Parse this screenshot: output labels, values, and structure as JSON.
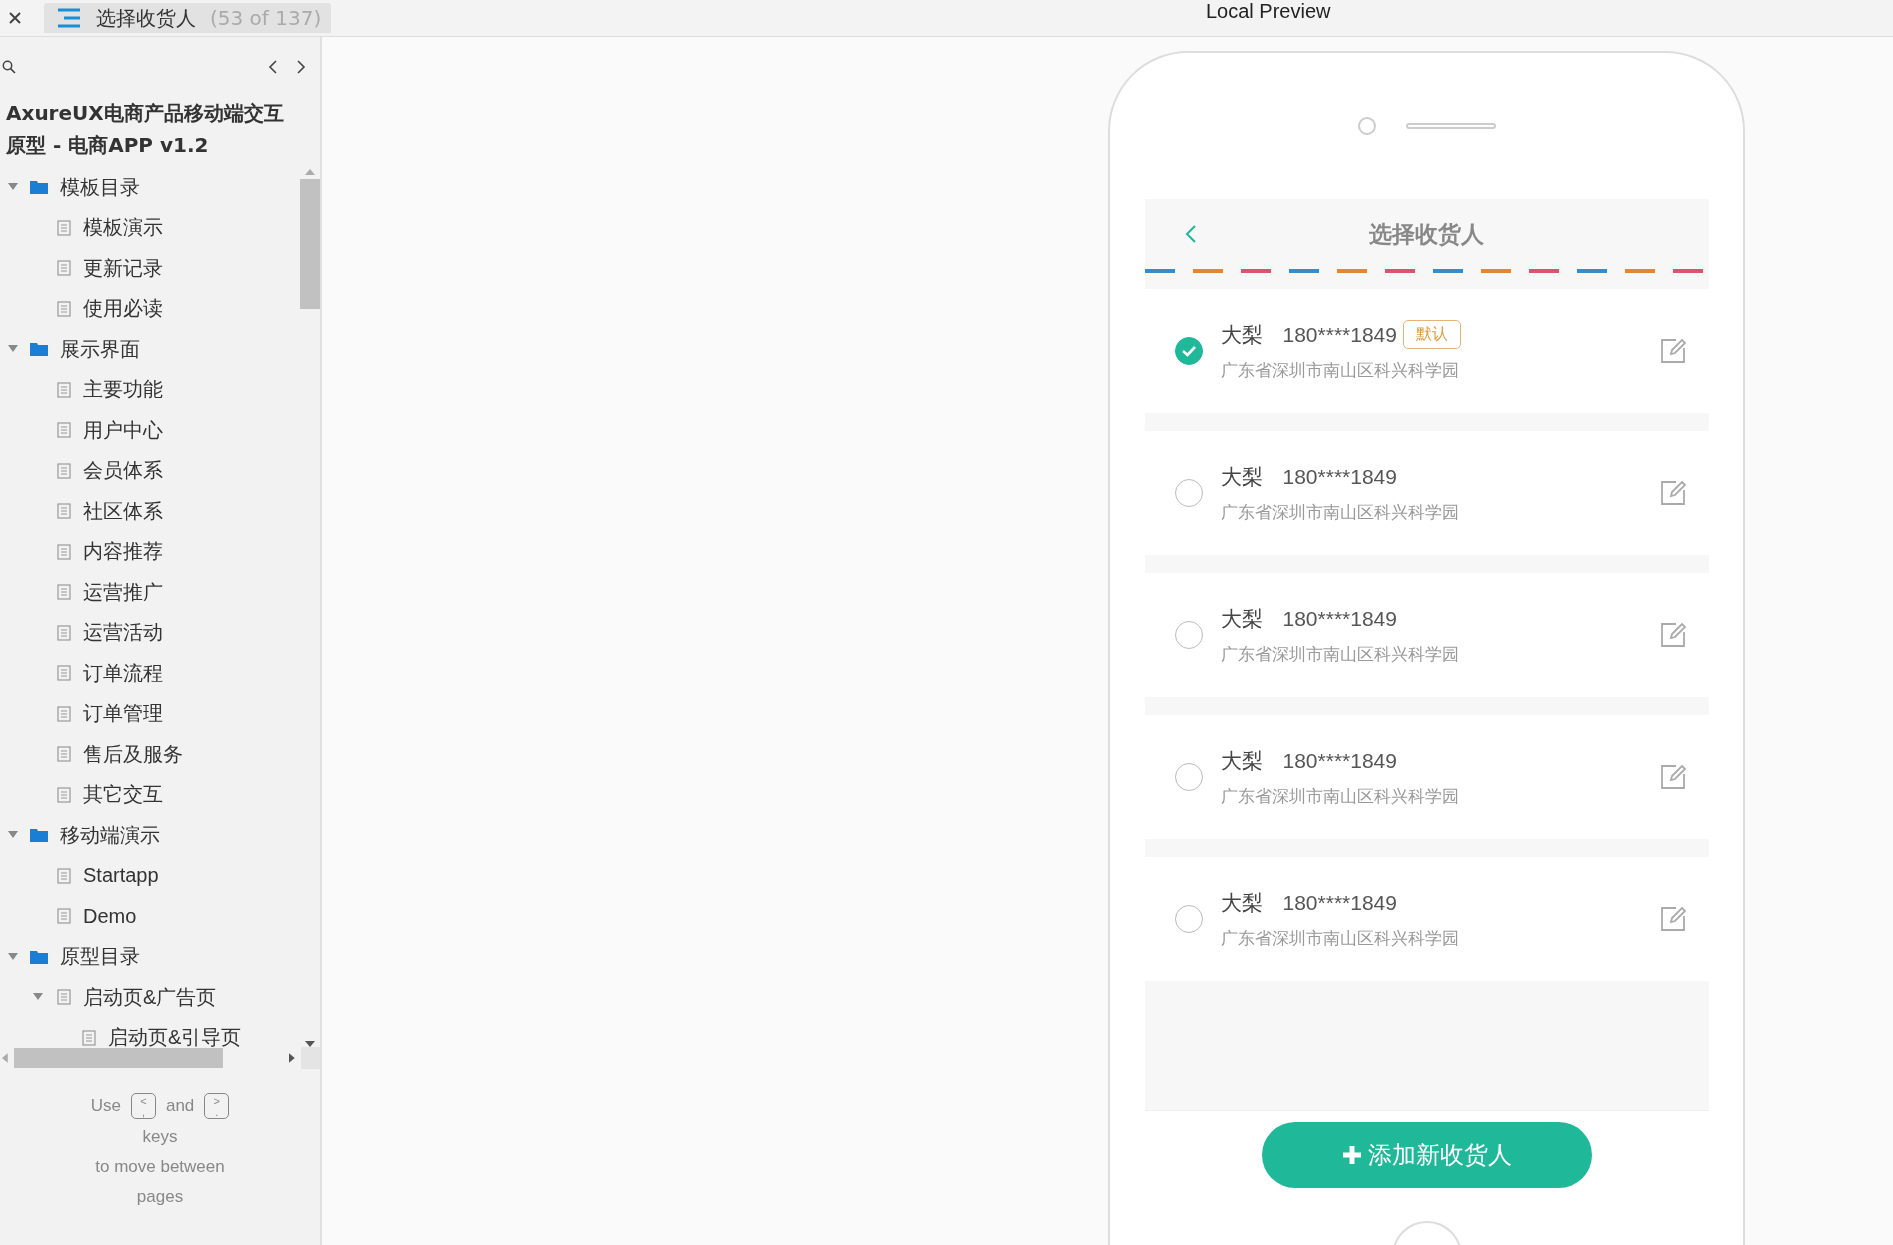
{
  "tab": {
    "title": "选择收货人",
    "count": "(53 of 137)"
  },
  "preview_title": "Local Preview",
  "sidebar": {
    "project_title": "AxureUX电商产品移动端交互原型 - 电商APP v1.2",
    "tree": [
      {
        "kind": "folder",
        "label": "模板目录",
        "expanded": true,
        "children": [
          {
            "kind": "page",
            "label": "模板演示"
          },
          {
            "kind": "page",
            "label": "更新记录"
          },
          {
            "kind": "page",
            "label": "使用必读"
          }
        ]
      },
      {
        "kind": "folder",
        "label": "展示界面",
        "expanded": true,
        "children": [
          {
            "kind": "page",
            "label": "主要功能"
          },
          {
            "kind": "page",
            "label": "用户中心"
          },
          {
            "kind": "page",
            "label": "会员体系"
          },
          {
            "kind": "page",
            "label": "社区体系"
          },
          {
            "kind": "page",
            "label": "内容推荐"
          },
          {
            "kind": "page",
            "label": "运营推广"
          },
          {
            "kind": "page",
            "label": "运营活动"
          },
          {
            "kind": "page",
            "label": "订单流程"
          },
          {
            "kind": "page",
            "label": "订单管理"
          },
          {
            "kind": "page",
            "label": "售后及服务"
          },
          {
            "kind": "page",
            "label": "其它交互"
          }
        ]
      },
      {
        "kind": "folder",
        "label": "移动端演示",
        "expanded": true,
        "children": [
          {
            "kind": "page",
            "label": "Startapp"
          },
          {
            "kind": "page",
            "label": "Demo"
          }
        ]
      },
      {
        "kind": "folder",
        "label": "原型目录",
        "expanded": true,
        "children": [
          {
            "kind": "page",
            "label": "启动页&广告页",
            "expanded": true,
            "children": [
              {
                "kind": "page",
                "label": "启动页&引导页"
              }
            ]
          }
        ]
      }
    ],
    "hint": {
      "use": "Use",
      "key_prev": {
        "top": "<",
        "bottom": ","
      },
      "and": "and",
      "key_next": {
        "top": ">",
        "bottom": "."
      },
      "keys": "keys",
      "to_move": "to move between",
      "pages": "pages"
    }
  },
  "app": {
    "title": "选择收货人",
    "addresses": [
      {
        "name": "大梨",
        "phone": "180****1849",
        "tag": "默认",
        "address": "广东省深圳市南山区科兴科学园",
        "selected": true
      },
      {
        "name": "大梨",
        "phone": "180****1849",
        "address": "广东省深圳市南山区科兴科学园",
        "selected": false
      },
      {
        "name": "大梨",
        "phone": "180****1849",
        "address": "广东省深圳市南山区科兴科学园",
        "selected": false
      },
      {
        "name": "大梨",
        "phone": "180****1849",
        "address": "广东省深圳市南山区科兴科学园",
        "selected": false
      },
      {
        "name": "大梨",
        "phone": "180****1849",
        "address": "广东省深圳市南山区科兴科学园",
        "selected": false
      }
    ],
    "add_button": "添加新收货人"
  }
}
